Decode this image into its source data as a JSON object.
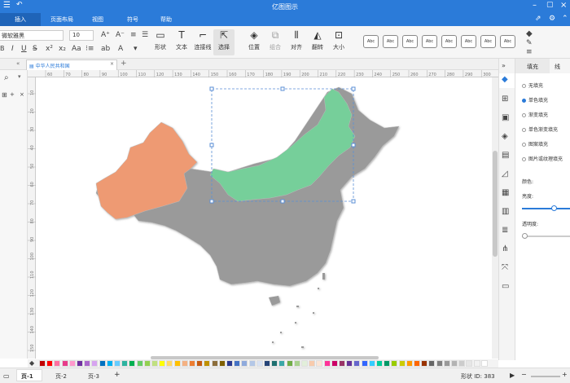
{
  "app": {
    "title": "亿图图示"
  },
  "menu": {
    "items": [
      "插入",
      "页面布局",
      "视图",
      "符号",
      "帮助"
    ]
  },
  "toolbar": {
    "font_name": "微软雅黑",
    "font_size": "10",
    "tools": [
      "形状",
      "文本",
      "连接线",
      "选择",
      "位置",
      "组合",
      "对齐",
      "翻转",
      "大小"
    ],
    "style_label": "Abc"
  },
  "tab": {
    "label": "中华人民共和国"
  },
  "ruler": {
    "h": [
      "60",
      "70",
      "80",
      "90",
      "100",
      "110",
      "120",
      "130",
      "140",
      "150",
      "160",
      "170",
      "180",
      "190",
      "200",
      "210",
      "220",
      "230",
      "240",
      "250",
      "260",
      "270",
      "280",
      "290",
      "300",
      "310"
    ],
    "v": [
      "10",
      "20",
      "30",
      "40",
      "50",
      "60",
      "70",
      "80",
      "90",
      "100",
      "110",
      "120",
      "130",
      "140",
      "150"
    ]
  },
  "right_panel": {
    "tab_fill": "填充",
    "tab_other": "线",
    "options": [
      "无填充",
      "单色填充",
      "渐变填充",
      "单色渐变填充",
      "图案填充",
      "图片或纹理填充"
    ],
    "selected_index": 1,
    "color_label": "颜色:",
    "brightness_label": "亮度:",
    "transparency_label": "透明度:",
    "brightness": 0.5,
    "transparency": 0
  },
  "status": {
    "pages": [
      "页-1",
      "页-2",
      "页-3"
    ],
    "active_page": "页-1",
    "shape_id": "形状 ID: 383",
    "zoom_label": "100%"
  },
  "colors": {
    "accent": "#2b7bd9",
    "xinjiang": "#ee9a73",
    "inner_mongolia": "#76cf9a",
    "map_gray": "#9a9a9a"
  },
  "palette": [
    "#c00000",
    "#ff0000",
    "#ff6fa0",
    "#e83c8a",
    "#ff99cc",
    "#7030a0",
    "#aa66cc",
    "#d6a3f0",
    "#0070c0",
    "#00b0f0",
    "#66ccff",
    "#2db3a0",
    "#00b050",
    "#66cc66",
    "#92d050",
    "#c0e080",
    "#ffff00",
    "#ffd966",
    "#ffc000",
    "#f4b183",
    "#ed7d31",
    "#c55a11",
    "#bf9000",
    "#8c6e3c",
    "#7f6000",
    "#2b3990",
    "#4472c4",
    "#8faadc",
    "#b4c7e7",
    "#dae3f3",
    "#264478",
    "#1f7070",
    "#3aa7a7",
    "#70ad47",
    "#a9d18e",
    "#e2efda",
    "#f8cbad",
    "#fbe5d6",
    "#ff3399",
    "#cc0066",
    "#993366",
    "#663399",
    "#6666cc",
    "#3366ff",
    "#33ccff",
    "#00cc99",
    "#009966",
    "#99cc00",
    "#cccc00",
    "#ff9900",
    "#ff6600",
    "#993300",
    "#666666",
    "#808080",
    "#999999",
    "#b3b3b3",
    "#cccccc",
    "#e6e6e6",
    "#f2f2f2",
    "#ffffff"
  ]
}
